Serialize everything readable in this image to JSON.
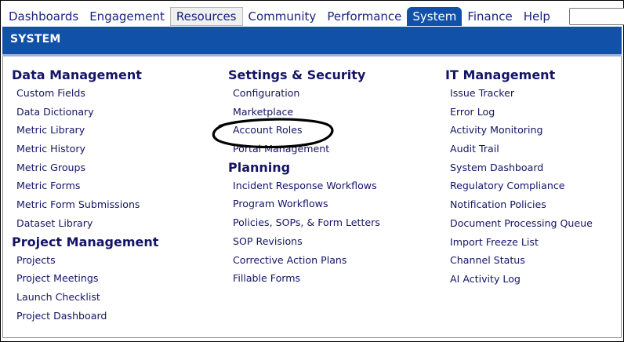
{
  "nav": {
    "tabs": [
      {
        "label": "Dashboards"
      },
      {
        "label": "Engagement"
      },
      {
        "label": "Resources"
      },
      {
        "label": "Community"
      },
      {
        "label": "Performance"
      },
      {
        "label": "System"
      },
      {
        "label": "Finance"
      },
      {
        "label": "Help"
      }
    ],
    "active_tab": "System",
    "hover_tab": "Resources",
    "search_value": ""
  },
  "section": {
    "title": "SYSTEM"
  },
  "columns": [
    {
      "groups": [
        {
          "title": "Data Management",
          "items": [
            "Custom Fields",
            "Data Dictionary",
            "Metric Library",
            "Metric History",
            "Metric Groups",
            "Metric Forms",
            "Metric Form Submissions",
            "Dataset Library"
          ]
        },
        {
          "title": "Project Management",
          "items": [
            "Projects",
            "Project Meetings",
            "Launch Checklist",
            "Project Dashboard"
          ]
        }
      ]
    },
    {
      "groups": [
        {
          "title": "Settings & Security",
          "items": [
            "Configuration",
            "Marketplace",
            "Account Roles",
            "Portal Management"
          ]
        },
        {
          "title": "Planning",
          "items": [
            "Incident Response Workflows",
            "Program Workflows",
            "Policies, SOPs, & Form Letters",
            "SOP Revisions",
            "Corrective Action Plans",
            "Fillable Forms"
          ]
        }
      ]
    },
    {
      "groups": [
        {
          "title": "IT Management",
          "items": [
            "Issue Tracker",
            "Error Log",
            "Activity Monitoring",
            "Audit Trail",
            "System Dashboard",
            "Regulatory Compliance",
            "Notification Policies",
            "Document Processing Queue",
            "Import Freeze List",
            "Channel Status",
            "AI Activity Log"
          ]
        }
      ]
    }
  ],
  "colors": {
    "brand_blue": "#1152a8",
    "link_navy": "#141466",
    "annotation": "#000000"
  }
}
